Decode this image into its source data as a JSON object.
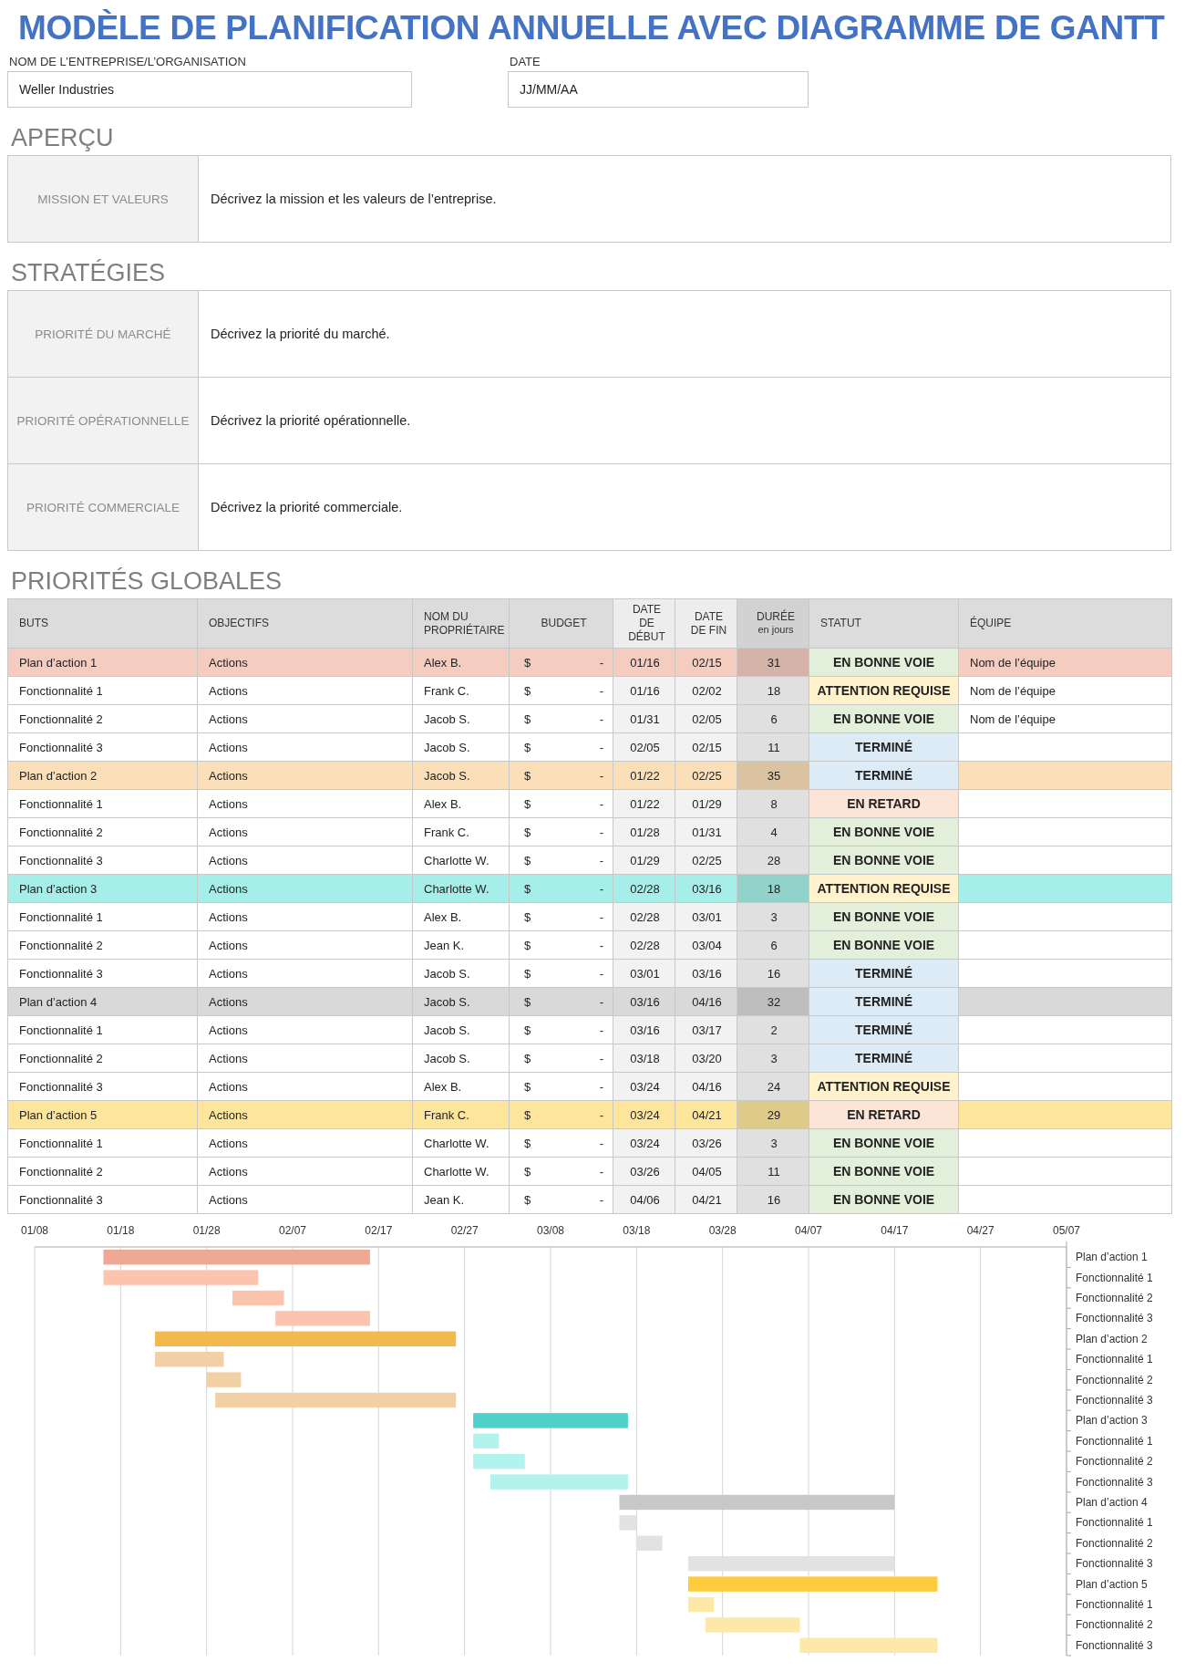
{
  "title": "MODÈLE DE PLANIFICATION ANNUELLE AVEC DIAGRAMME DE GANTT",
  "fields": [
    {
      "label": "NOM DE L’ENTREPRISE/L’ORGANISATION",
      "value": "Weller Industries"
    },
    {
      "label": "DATE",
      "value": "JJ/MM/AA"
    }
  ],
  "overview": {
    "heading": "APERÇU",
    "rows": [
      {
        "label": "MISSION ET VALEURS",
        "text": "Décrivez la mission et les valeurs de l’entreprise."
      }
    ]
  },
  "strategies": {
    "heading": "STRATÉGIES",
    "rows": [
      {
        "label": "PRIORITÉ DU MARCHÉ",
        "text": "Décrivez la priorité du marché."
      },
      {
        "label": "PRIORITÉ OPÉRATIONNELLE",
        "text": "Décrivez la priorité opérationnelle."
      },
      {
        "label": "PRIORITÉ COMMERCIALE",
        "text": "Décrivez la priorité commerciale."
      }
    ]
  },
  "priorities": {
    "heading": "PRIORITÉS GLOBALES",
    "columns": [
      {
        "label": "BUTS",
        "kind": "text"
      },
      {
        "label": "OBJECTIFS",
        "kind": "text"
      },
      {
        "label": "NOM DU PROPRIÉTAIRE",
        "kind": "text"
      },
      {
        "label": "BUDGET",
        "kind": "center"
      },
      {
        "label": "DATE DE DÉBUT",
        "kind": "date"
      },
      {
        "label": "DATE DE FIN",
        "kind": "date"
      },
      {
        "label": "DURÉE",
        "note": "en jours",
        "kind": "duration"
      },
      {
        "label": "STATUT",
        "kind": "text"
      },
      {
        "label": "ÉQUIPE",
        "kind": "text"
      }
    ],
    "rows": [
      {
        "kind": "plan",
        "color": "#f4ccc0",
        "goal": "Plan d’action 1",
        "objective": "Actions",
        "owner": "Alex B.",
        "currency": "$",
        "amount": "-",
        "start": "01/16",
        "end": "02/15",
        "duration": "31",
        "status": {
          "kind": "on_track",
          "label": "EN BONNE VOIE"
        },
        "team": "Nom de l’équipe"
      },
      {
        "kind": "feature",
        "goal": "Fonctionnalité 1",
        "objective": "Actions",
        "owner": "Frank C.",
        "currency": "$",
        "amount": "-",
        "start": "01/16",
        "end": "02/02",
        "duration": "18",
        "status": {
          "kind": "attention",
          "label": "ATTENTION REQUISE"
        },
        "team": "Nom de l’équipe"
      },
      {
        "kind": "feature",
        "goal": "Fonctionnalité 2",
        "objective": "Actions",
        "owner": "Jacob S.",
        "currency": "$",
        "amount": "-",
        "start": "01/31",
        "end": "02/05",
        "duration": "6",
        "status": {
          "kind": "on_track",
          "label": "EN BONNE VOIE"
        },
        "team": "Nom de l’équipe"
      },
      {
        "kind": "feature",
        "goal": "Fonctionnalité 3",
        "objective": "Actions",
        "owner": "Jacob S.",
        "currency": "$",
        "amount": "-",
        "start": "02/05",
        "end": "02/15",
        "duration": "11",
        "status": {
          "kind": "done",
          "label": "TERMINÉ"
        }
      },
      {
        "kind": "plan",
        "color": "#fadfb8",
        "goal": "Plan d’action 2",
        "objective": "Actions",
        "owner": "Jacob S.",
        "currency": "$",
        "amount": "-",
        "start": "01/22",
        "end": "02/25",
        "duration": "35",
        "status": {
          "kind": "done",
          "label": "TERMINÉ"
        }
      },
      {
        "kind": "feature",
        "goal": "Fonctionnalité 1",
        "objective": "Actions",
        "owner": "Alex B.",
        "currency": "$",
        "amount": "-",
        "start": "01/22",
        "end": "01/29",
        "duration": "8",
        "status": {
          "kind": "late",
          "label": "EN RETARD"
        }
      },
      {
        "kind": "feature",
        "goal": "Fonctionnalité 2",
        "objective": "Actions",
        "owner": "Frank C.",
        "currency": "$",
        "amount": "-",
        "start": "01/28",
        "end": "01/31",
        "duration": "4",
        "status": {
          "kind": "on_track",
          "label": "EN BONNE VOIE"
        }
      },
      {
        "kind": "feature",
        "goal": "Fonctionnalité 3",
        "objective": "Actions",
        "owner": "Charlotte W.",
        "currency": "$",
        "amount": "-",
        "start": "01/29",
        "end": "02/25",
        "duration": "28",
        "status": {
          "kind": "on_track",
          "label": "EN BONNE VOIE"
        }
      },
      {
        "kind": "plan",
        "color": "#a5efe8",
        "goal": "Plan d’action 3",
        "objective": "Actions",
        "owner": "Charlotte W.",
        "currency": "$",
        "amount": "-",
        "start": "02/28",
        "end": "03/16",
        "duration": "18",
        "status": {
          "kind": "attention",
          "label": "ATTENTION REQUISE"
        }
      },
      {
        "kind": "feature",
        "goal": "Fonctionnalité 1",
        "objective": "Actions",
        "owner": "Alex B.",
        "currency": "$",
        "amount": "-",
        "start": "02/28",
        "end": "03/01",
        "duration": "3",
        "status": {
          "kind": "on_track",
          "label": "EN BONNE VOIE"
        }
      },
      {
        "kind": "feature",
        "goal": "Fonctionnalité 2",
        "objective": "Actions",
        "owner": "Jean K.",
        "currency": "$",
        "amount": "-",
        "start": "02/28",
        "end": "03/04",
        "duration": "6",
        "status": {
          "kind": "on_track",
          "label": "EN BONNE VOIE"
        }
      },
      {
        "kind": "feature",
        "goal": "Fonctionnalité 3",
        "objective": "Actions",
        "owner": "Jacob S.",
        "currency": "$",
        "amount": "-",
        "start": "03/01",
        "end": "03/16",
        "duration": "16",
        "status": {
          "kind": "done",
          "label": "TERMINÉ"
        }
      },
      {
        "kind": "plan",
        "color": "#d9d9d9",
        "goal": "Plan d’action 4",
        "objective": "Actions",
        "owner": "Jacob S.",
        "currency": "$",
        "amount": "-",
        "start": "03/16",
        "end": "04/16",
        "duration": "32",
        "status": {
          "kind": "done",
          "label": "TERMINÉ"
        }
      },
      {
        "kind": "feature",
        "goal": "Fonctionnalité 1",
        "objective": "Actions",
        "owner": "Jacob S.",
        "currency": "$",
        "amount": "-",
        "start": "03/16",
        "end": "03/17",
        "duration": "2",
        "status": {
          "kind": "done",
          "label": "TERMINÉ"
        }
      },
      {
        "kind": "feature",
        "goal": "Fonctionnalité 2",
        "objective": "Actions",
        "owner": "Jacob S.",
        "currency": "$",
        "amount": "-",
        "start": "03/18",
        "end": "03/20",
        "duration": "3",
        "status": {
          "kind": "done",
          "label": "TERMINÉ"
        }
      },
      {
        "kind": "feature",
        "goal": "Fonctionnalité 3",
        "objective": "Actions",
        "owner": "Alex B.",
        "currency": "$",
        "amount": "-",
        "start": "03/24",
        "end": "04/16",
        "duration": "24",
        "status": {
          "kind": "attention",
          "label": "ATTENTION REQUISE"
        }
      },
      {
        "kind": "plan",
        "color": "#fde69c",
        "goal": "Plan d’action 5",
        "objective": "Actions",
        "owner": "Frank C.",
        "currency": "$",
        "amount": "-",
        "start": "03/24",
        "end": "04/21",
        "duration": "29",
        "status": {
          "kind": "late",
          "label": "EN RETARD"
        }
      },
      {
        "kind": "feature",
        "goal": "Fonctionnalité 1",
        "objective": "Actions",
        "owner": "Charlotte W.",
        "currency": "$",
        "amount": "-",
        "start": "03/24",
        "end": "03/26",
        "duration": "3",
        "status": {
          "kind": "on_track",
          "label": "EN BONNE VOIE"
        }
      },
      {
        "kind": "feature",
        "goal": "Fonctionnalité 2",
        "objective": "Actions",
        "owner": "Charlotte W.",
        "currency": "$",
        "amount": "-",
        "start": "03/26",
        "end": "04/05",
        "duration": "11",
        "status": {
          "kind": "on_track",
          "label": "EN BONNE VOIE"
        }
      },
      {
        "kind": "feature",
        "goal": "Fonctionnalité 3",
        "objective": "Actions",
        "owner": "Jean K.",
        "currency": "$",
        "amount": "-",
        "start": "04/06",
        "end": "04/21",
        "duration": "16",
        "status": {
          "kind": "on_track",
          "label": "EN BONNE VOIE"
        }
      }
    ]
  },
  "gantt": {
    "axis_labels": [
      "01/08",
      "01/18",
      "01/28",
      "02/07",
      "02/17",
      "02/27",
      "03/08",
      "03/18",
      "03/28",
      "04/07",
      "04/17",
      "04/27",
      "05/07"
    ],
    "rows": [
      {
        "label": "Plan d’action 1",
        "color": "#eea894"
      },
      {
        "label": "Fonctionnalité 1",
        "color": "#fbc4ae"
      },
      {
        "label": "Fonctionnalité 2",
        "color": "#fbc4ae"
      },
      {
        "label": "Fonctionnalité 3",
        "color": "#fbc4ae"
      },
      {
        "label": "Plan d’action 2",
        "color": "#f2b950"
      },
      {
        "label": "Fonctionnalité 1",
        "color": "#f2d0a6"
      },
      {
        "label": "Fonctionnalité 2",
        "color": "#f2d0a6"
      },
      {
        "label": "Fonctionnalité 3",
        "color": "#f2d0a6"
      },
      {
        "label": "Plan d’action 3",
        "color": "#4fd0c8"
      },
      {
        "label": "Fonctionnalité 1",
        "color": "#b3f3ee"
      },
      {
        "label": "Fonctionnalité 2",
        "color": "#b3f3ee"
      },
      {
        "label": "Fonctionnalité 3",
        "color": "#b3f3ee"
      },
      {
        "label": "Plan d’action 4",
        "color": "#c8c8c8"
      },
      {
        "label": "Fonctionnalité 1",
        "color": "#e2e2e2"
      },
      {
        "label": "Fonctionnalité 2",
        "color": "#e2e2e2"
      },
      {
        "label": "Fonctionnalité 3",
        "color": "#e2e2e2"
      },
      {
        "label": "Plan d’action 5",
        "color": "#fccc3c"
      },
      {
        "label": "Fonctionnalité 1",
        "color": "#fde8a8"
      },
      {
        "label": "Fonctionnalité 2",
        "color": "#fde8a8"
      },
      {
        "label": "Fonctionnalité 3",
        "color": "#fde8a8"
      }
    ]
  }
}
